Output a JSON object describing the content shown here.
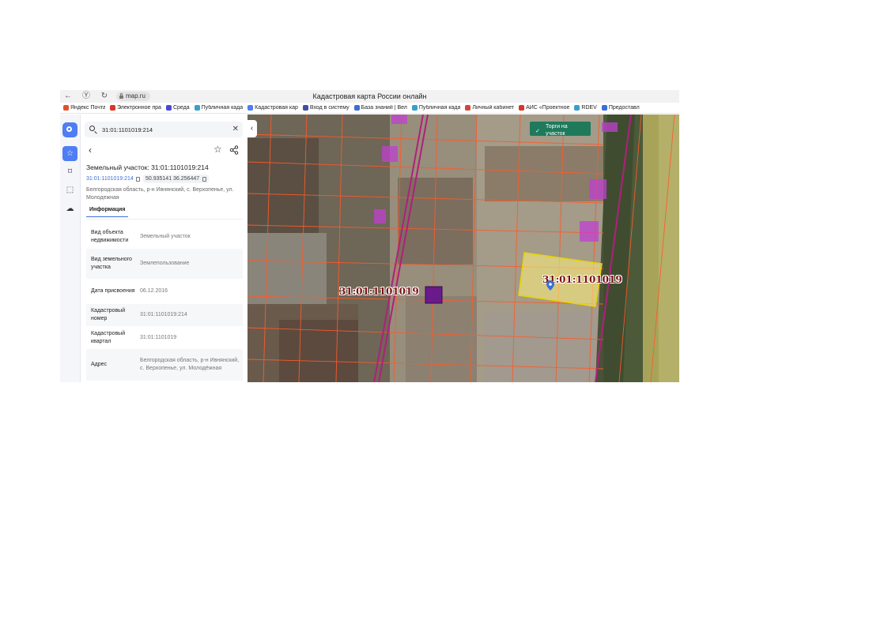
{
  "browser": {
    "url": "map.ru",
    "window_title": "Кадастровая карта России онлайн",
    "bookmarks": [
      {
        "label": "Яндекс Почта",
        "icon": "mail-icon",
        "color": "#e0512b"
      },
      {
        "label": "Электронное пра",
        "icon": "arrow-up-icon",
        "color": "#d9352b"
      },
      {
        "label": "Среда",
        "icon": "sreda-icon",
        "color": "#4a47d8"
      },
      {
        "label": "Публичная када",
        "icon": "public-map-icon",
        "color": "#3aa0c8"
      },
      {
        "label": "Кадастровая кар",
        "icon": "cadastre-icon",
        "color": "#4f7df3"
      },
      {
        "label": "Вход в систему",
        "icon": "login-icon",
        "color": "#3f4fa8"
      },
      {
        "label": "База знаний | Вел",
        "icon": "knowledge-icon",
        "color": "#3b6fd8"
      },
      {
        "label": "Публичная када",
        "icon": "public-map-icon",
        "color": "#3aa0c8"
      },
      {
        "label": "Личный кабинет",
        "icon": "gmail-icon",
        "color": "#d44638"
      },
      {
        "label": "АИС «Проектное",
        "icon": "arrow-up-icon",
        "color": "#d9352b"
      },
      {
        "label": "RDEV",
        "icon": "rdev-icon",
        "color": "#3aa0c8"
      },
      {
        "label": "Предоставл",
        "icon": "service-icon",
        "color": "#3b6fd8"
      }
    ]
  },
  "search": {
    "value": "31:01:1101019:214"
  },
  "object": {
    "title": "Земельный участок: 31:01:1101019:214",
    "cad_link": "31:01:1101019:214",
    "coords": "50.935141 36.256447",
    "address": "Белгородская область, р-н Ивнянский, с. Верхопенье, ул. Молодежная"
  },
  "tabs": {
    "info": "Информация"
  },
  "info_rows": [
    {
      "label": "Вид объекта недвижимости",
      "value": "Земельный участок"
    },
    {
      "label": "Вид земельного участка",
      "value": "Землепользование"
    },
    {
      "label": "Дата присвоения",
      "value": "06.12.2016"
    },
    {
      "label": "Кадастровый номер",
      "value": "31:01:1101019:214"
    },
    {
      "label": "Кадастровый квартал",
      "value": "31:01:1101019"
    },
    {
      "label": "Адрес",
      "value": "Белгородская область, р-н Ивнянский, с. Верхопенье, ул. Молодёжная"
    }
  ],
  "map": {
    "torgi_label": "Торги на участок",
    "quarter_labels": [
      "31:01:1101019",
      "31:01:1101019"
    ],
    "colors": {
      "parcel_line": "#ff5a2a",
      "road_line": "#b0207a",
      "highlight_fill": "#fff27a",
      "highlight_stroke": "#e8d400",
      "purple_fill": "#c040d0",
      "selected_dark": "#6a1a8a"
    }
  }
}
